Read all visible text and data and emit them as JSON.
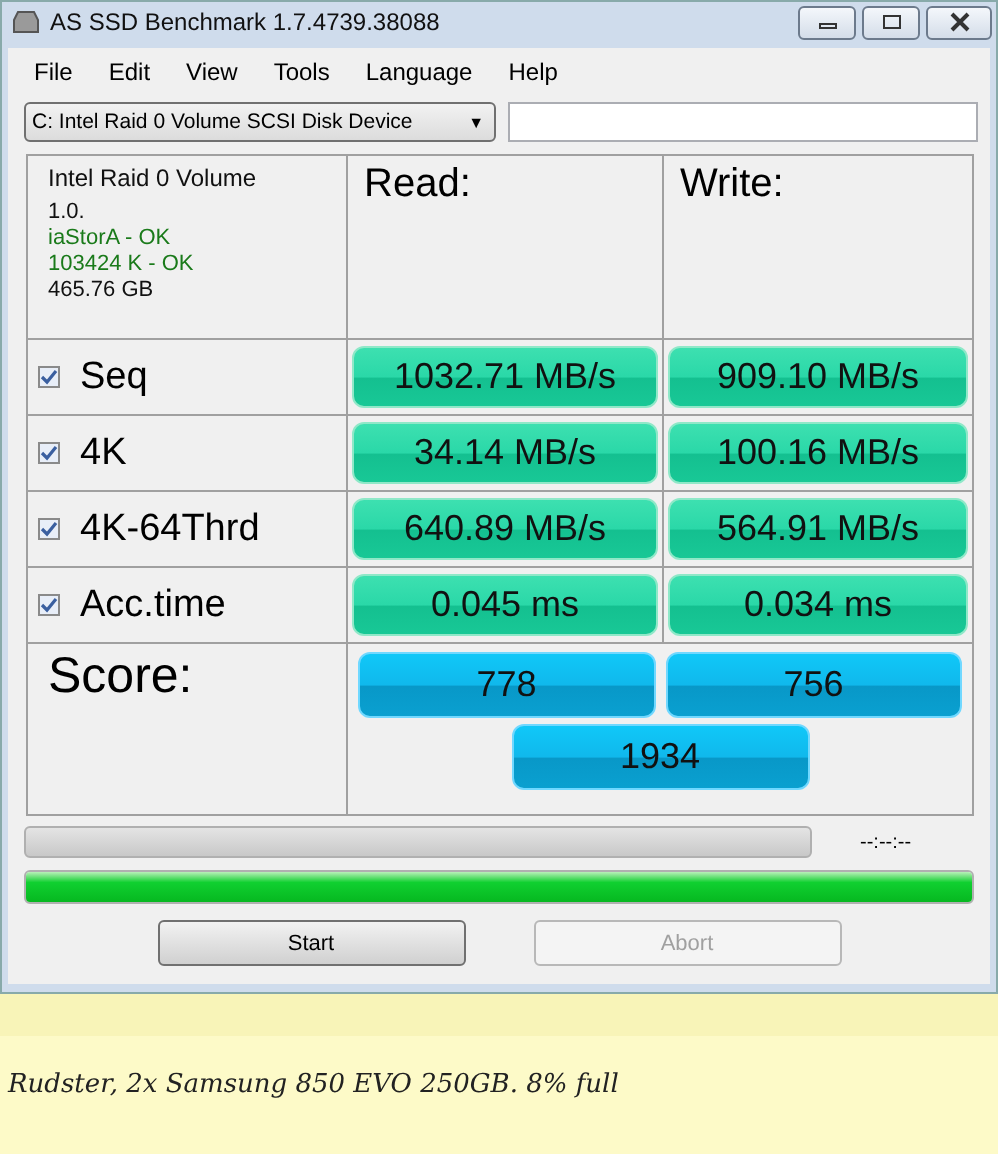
{
  "window": {
    "title": "AS SSD Benchmark 1.7.4739.38088"
  },
  "menu": [
    "File",
    "Edit",
    "View",
    "Tools",
    "Language",
    "Help"
  ],
  "drive_select": {
    "value": "C: Intel Raid 0 Volume SCSI Disk Device",
    "caret": "▼"
  },
  "info": {
    "name": "Intel Raid 0 Volume",
    "lines": [
      {
        "text": "1.0.",
        "ok": false
      },
      {
        "text": "iaStorA - OK",
        "ok": true
      },
      {
        "text": "103424 K - OK",
        "ok": true
      },
      {
        "text": "465.76 GB",
        "ok": false
      }
    ]
  },
  "columns": [
    "Read:",
    "Write:"
  ],
  "tests": [
    {
      "name": "Seq",
      "checked": true,
      "read": "1032.71 MB/s",
      "write": "909.10 MB/s"
    },
    {
      "name": "4K",
      "checked": true,
      "read": "34.14 MB/s",
      "write": "100.16 MB/s"
    },
    {
      "name": "4K-64Thrd",
      "checked": true,
      "read": "640.89 MB/s",
      "write": "564.91 MB/s"
    },
    {
      "name": "Acc.time",
      "checked": true,
      "read": "0.045 ms",
      "write": "0.034 ms"
    }
  ],
  "score": {
    "label": "Score:",
    "read": "778",
    "write": "756",
    "total": "1934"
  },
  "test_progress": {
    "level": 0,
    "time": "--:--:--"
  },
  "total_progress": {
    "level": 1
  },
  "buttons": [
    {
      "label": "Start",
      "disabled": false
    },
    {
      "label": "Abort",
      "disabled": true
    }
  ],
  "note": "Rudster, 2x Samsung 850 EVO 250GB. 8% full"
}
